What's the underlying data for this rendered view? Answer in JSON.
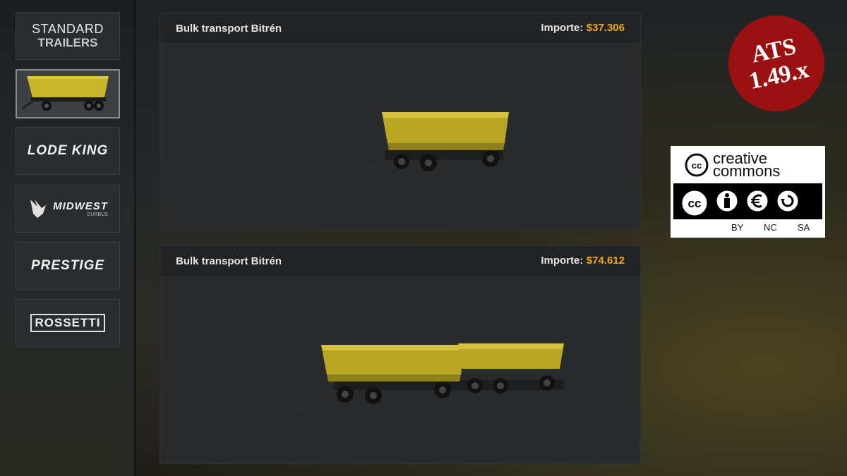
{
  "sidebar": {
    "items": [
      {
        "id": "standard",
        "line1": "STANDARD",
        "line2": "TRAILERS"
      },
      {
        "id": "bulk-thumb",
        "selected": true
      },
      {
        "id": "lode-king",
        "label": "LODE KING"
      },
      {
        "id": "midwest",
        "label": "MIDWEST",
        "sub": "DURBUS"
      },
      {
        "id": "prestige",
        "label": "PRESTIGE"
      },
      {
        "id": "rossetti",
        "label": "ROSSETTI"
      }
    ]
  },
  "panels": [
    {
      "title": "Bulk transport Bitrén",
      "price_label": "Importe:",
      "price": "$37.306"
    },
    {
      "title": "Bulk transport Bitrén",
      "price_label": "Importe:",
      "price": "$74.612"
    }
  ],
  "badge": {
    "line1": "ATS",
    "line2": "1.49.x"
  },
  "license": {
    "word1": "creative",
    "word2": "commons",
    "cc": "cc",
    "tags": [
      "BY",
      "NC",
      "SA"
    ]
  },
  "colors": {
    "price": "#f2a81c",
    "trailer": "#c9b52a",
    "badge": "#9b1010"
  }
}
